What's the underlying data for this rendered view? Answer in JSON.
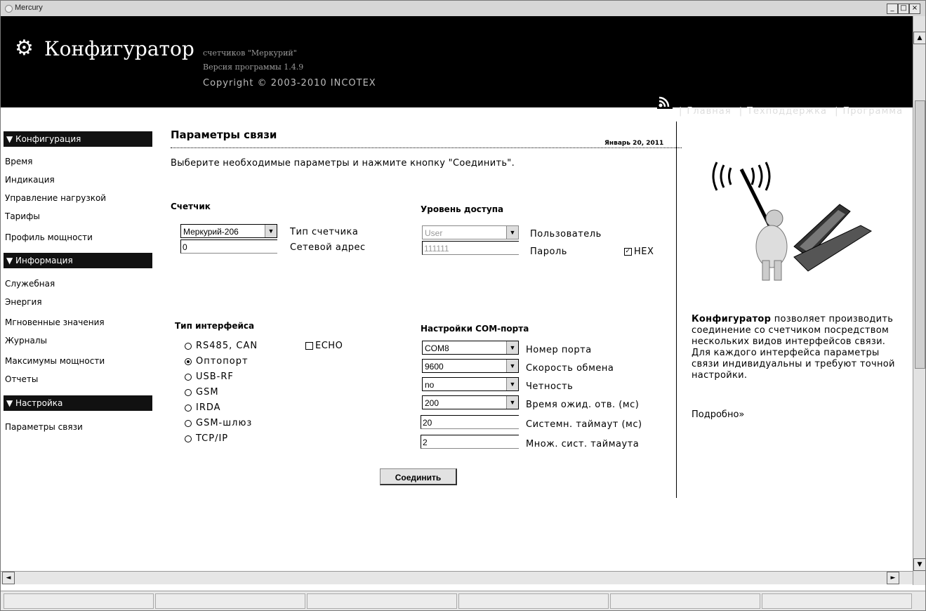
{
  "window": {
    "title": "Mercury"
  },
  "header": {
    "title": "Конфигуратор",
    "subtitle1": "счетчиков \"Меркурий\"",
    "subtitle2": "Версия программы 1.4.9",
    "copyright": "Copyright © 2003-2010  INCOTEX",
    "nav": [
      "Главная",
      "Техподдержка",
      "Программа"
    ]
  },
  "sidebar": {
    "sections": [
      {
        "title": "▼ Конфигурация",
        "items": [
          "Время",
          "Индикация",
          "Управление нагрузкой",
          "Тарифы",
          "Профиль мощности"
        ]
      },
      {
        "title": "▼ Информация",
        "items": [
          "Служебная",
          "Энергия",
          "Мгновенные значения",
          "Журналы",
          "Максимумы мощности",
          "Отчеты"
        ]
      },
      {
        "title": "▼ Настройка",
        "items": [
          "Параметры связи"
        ]
      }
    ]
  },
  "main": {
    "title": "Параметры связи",
    "date": "Январь 20, 2011",
    "description": "Выберите необходимые параметры и нажмите кнопку \"Соединить\".",
    "meter": {
      "label": "Счетчик",
      "type_value": "Меркурий-206",
      "type_label": "Тип счетчика",
      "address_value": "0",
      "address_label": "Сетевой адрес"
    },
    "access": {
      "label": "Уровень доступа",
      "level_value": "User",
      "level_label": "Пользователь",
      "password_value": "111111",
      "password_label": "Пароль",
      "hex_label": "HEX",
      "hex_checked": true
    },
    "interface": {
      "label": "Тип интерфейса",
      "options": [
        "RS485, CAN",
        "Оптопорт",
        "USB-RF",
        "GSM",
        "IRDA",
        "GSM-шлюз",
        "TCP/IP"
      ],
      "selected": "Оптопорт",
      "echo_label": "ECHO",
      "echo_checked": false
    },
    "com": {
      "label": "Настройки COM-порта",
      "port_value": "COM8",
      "port_label": "Номер порта",
      "speed_value": "9600",
      "speed_label": "Скорость обмена",
      "parity_value": "no",
      "parity_label": "Четность",
      "wait_value": "200",
      "wait_label": "Время ожид. отв. (мс)",
      "timeout_value": "20",
      "timeout_label": "Системн. таймаут (мс)",
      "mult_value": "2",
      "mult_label": "Множ. сист. таймаута"
    },
    "connect_label": "Соединить"
  },
  "right": {
    "text_bold": "Конфигуратор",
    "text": " позволяет производить соединение со счетчиком посредством нескольких видов интерфейсов связи. Для каждого интерфейса параметры связи индивидуальны и требуют точной настройки.",
    "more": "Подробно»"
  }
}
